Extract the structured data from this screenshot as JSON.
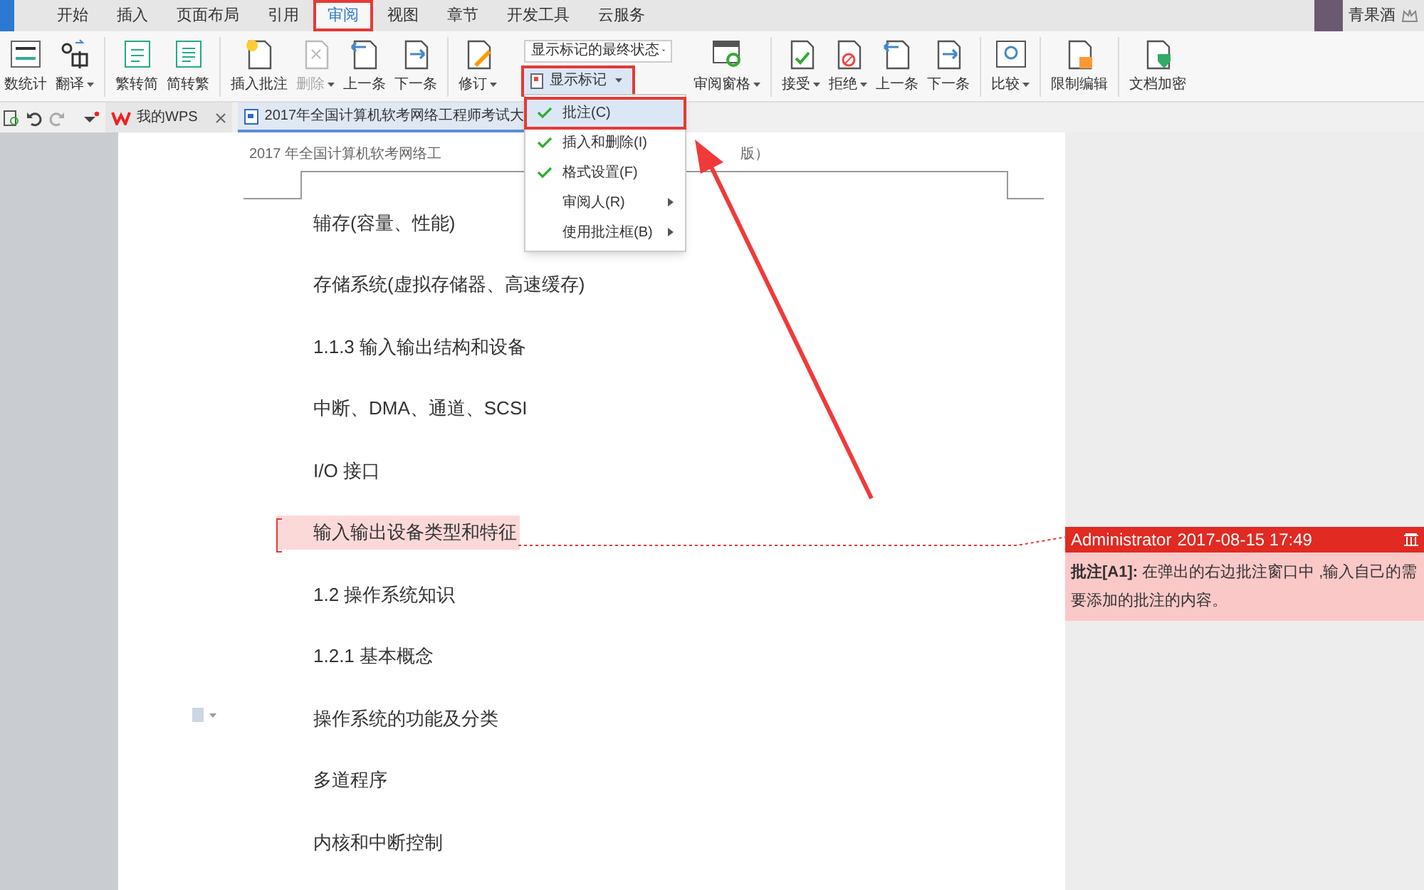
{
  "menu_tabs": [
    {
      "label": "开始",
      "selected": false
    },
    {
      "label": "插入",
      "selected": false
    },
    {
      "label": "页面布局",
      "selected": false
    },
    {
      "label": "引用",
      "selected": false
    },
    {
      "label": "审阅",
      "selected": true
    },
    {
      "label": "视图",
      "selected": false
    },
    {
      "label": "章节",
      "selected": false
    },
    {
      "label": "开发工具",
      "selected": false
    },
    {
      "label": "云服务",
      "selected": false
    }
  ],
  "user": {
    "name": "青果酒"
  },
  "ribbon_left": [
    {
      "kind": "count",
      "label": "数统计",
      "has_menu": false,
      "disabled": false
    },
    {
      "kind": "translate",
      "label": "翻译",
      "has_menu": true,
      "disabled": false
    },
    {
      "kind": "sep"
    },
    {
      "kind": "simp",
      "label": "繁转简",
      "has_menu": false,
      "disabled": false
    },
    {
      "kind": "trad",
      "label": "简转繁",
      "has_menu": false,
      "disabled": false
    },
    {
      "kind": "sep"
    },
    {
      "kind": "insert",
      "label": "插入批注",
      "has_menu": false,
      "disabled": false
    },
    {
      "kind": "delete",
      "label": "删除",
      "has_menu": true,
      "disabled": true
    },
    {
      "kind": "prev",
      "label": "上一条",
      "has_menu": false,
      "disabled": false
    },
    {
      "kind": "next",
      "label": "下一条",
      "has_menu": false,
      "disabled": false
    },
    {
      "kind": "sep"
    },
    {
      "kind": "revise",
      "label": "修订",
      "has_menu": true,
      "disabled": false
    }
  ],
  "markup_state": {
    "value": "显示标记的最终状态"
  },
  "show_markup": {
    "label": "显示标记",
    "has_menu": true,
    "highlighted": true
  },
  "ribbon_right": [
    {
      "kind": "pane",
      "label": "审阅窗格",
      "has_menu": true,
      "disabled": false
    },
    {
      "kind": "sep"
    },
    {
      "kind": "accept",
      "label": "接受",
      "has_menu": true,
      "disabled": false
    },
    {
      "kind": "reject",
      "label": "拒绝",
      "has_menu": true,
      "disabled": false
    },
    {
      "kind": "prev",
      "label": "上一条",
      "has_menu": false,
      "disabled": false
    },
    {
      "kind": "next",
      "label": "下一条",
      "has_menu": false,
      "disabled": false
    },
    {
      "kind": "sep"
    },
    {
      "kind": "compare",
      "label": "比较",
      "has_menu": true,
      "disabled": false
    },
    {
      "kind": "sep"
    },
    {
      "kind": "lock",
      "label": "限制编辑",
      "has_menu": false,
      "disabled": false
    },
    {
      "kind": "sep"
    },
    {
      "kind": "encrypt",
      "label": "文档加密",
      "has_menu": false,
      "disabled": false
    }
  ],
  "doc_tabs": [
    {
      "label": "我的WPS",
      "selected": false,
      "closable": true
    },
    {
      "label": "2017年全国计算机软考网络工程师考试大",
      "selected": true,
      "closable": false
    }
  ],
  "markup_menu": [
    {
      "label": "批注(C)",
      "checked": true,
      "submenu": false,
      "selected": true
    },
    {
      "label": "插入和删除(I)",
      "checked": true,
      "submenu": false,
      "selected": false
    },
    {
      "label": "格式设置(F)",
      "checked": true,
      "submenu": false,
      "selected": false
    },
    {
      "label": "审阅人(R)",
      "checked": false,
      "submenu": true,
      "selected": false
    },
    {
      "label": "使用批注框(B)",
      "checked": false,
      "submenu": true,
      "selected": false
    }
  ],
  "page": {
    "header_left": "2017 年全国计算机软考网络工",
    "header_right": "版）",
    "paragraphs": [
      {
        "text": "辅存(容量、性能)",
        "commented": false
      },
      {
        "text": "存储系统(虚拟存储器、高速缓存)",
        "commented": false
      },
      {
        "text": "1.1.3 输入输出结构和设备",
        "commented": false
      },
      {
        "text": "中断、DMA、通道、SCSI",
        "commented": false
      },
      {
        "text": "I/O 接口",
        "commented": false
      },
      {
        "text": "输入输出设备类型和特征",
        "commented": true
      },
      {
        "text": "1.2 操作系统知识",
        "commented": false
      },
      {
        "text": "1.2.1 基本概念",
        "commented": false
      },
      {
        "text": "操作系统的功能及分类",
        "commented": false
      },
      {
        "text": "多道程序",
        "commented": false
      },
      {
        "text": "内核和中断控制",
        "commented": false
      }
    ]
  },
  "comment": {
    "author": "Administrator",
    "time": "2017-08-15 17:49",
    "tag": "批注[A1]:",
    "text": "在弹出的右边批注窗口中 ,输入自己的需要添加的批注的内容。"
  }
}
